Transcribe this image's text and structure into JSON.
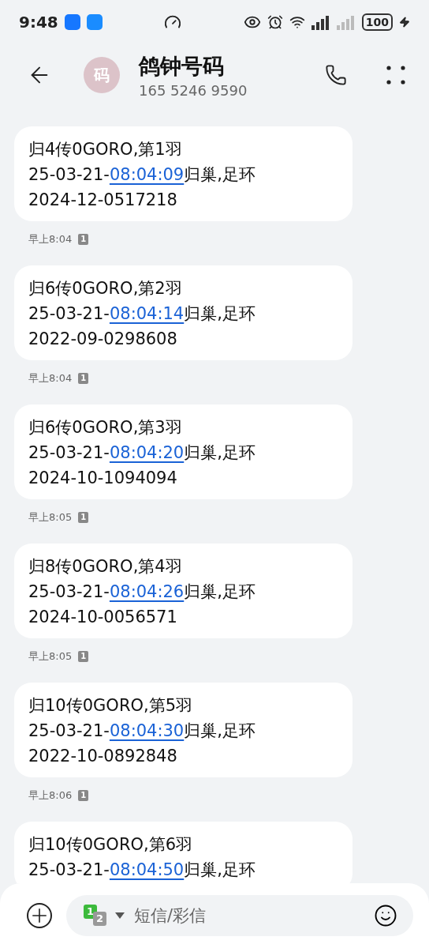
{
  "status_bar": {
    "time": "9:48",
    "battery": "100"
  },
  "header": {
    "avatar_text": "码",
    "title": "鸽钟号码",
    "number": "165 5246 9590"
  },
  "messages": [
    {
      "title": "归4传0GORO,第1羽",
      "date": "25-03-21-",
      "time": "08:04:09",
      "suffix": "归巢,足环",
      "ring": "2024-12-0517218",
      "sent": "早上8:04",
      "sim": "1"
    },
    {
      "title": "归6传0GORO,第2羽",
      "date": "25-03-21-",
      "time": "08:04:14",
      "suffix": "归巢,足环",
      "ring": "2022-09-0298608",
      "sent": "早上8:04",
      "sim": "1"
    },
    {
      "title": "归6传0GORO,第3羽",
      "date": "25-03-21-",
      "time": "08:04:20",
      "suffix": "归巢,足环",
      "ring": "2024-10-1094094",
      "sent": "早上8:05",
      "sim": "1"
    },
    {
      "title": "归8传0GORO,第4羽",
      "date": "25-03-21-",
      "time": "08:04:26",
      "suffix": "归巢,足环",
      "ring": "2024-10-0056571",
      "sent": "早上8:05",
      "sim": "1"
    },
    {
      "title": "归10传0GORO,第5羽",
      "date": "25-03-21-",
      "time": "08:04:30",
      "suffix": "归巢,足环",
      "ring": "2022-10-0892848",
      "sent": "早上8:06",
      "sim": "1"
    },
    {
      "title": "归10传0GORO,第6羽",
      "date": "25-03-21-",
      "time": "08:04:50",
      "suffix": "归巢,足环"
    }
  ],
  "composer": {
    "sim_primary": "1",
    "sim_secondary": "2",
    "placeholder": "短信/彩信"
  }
}
